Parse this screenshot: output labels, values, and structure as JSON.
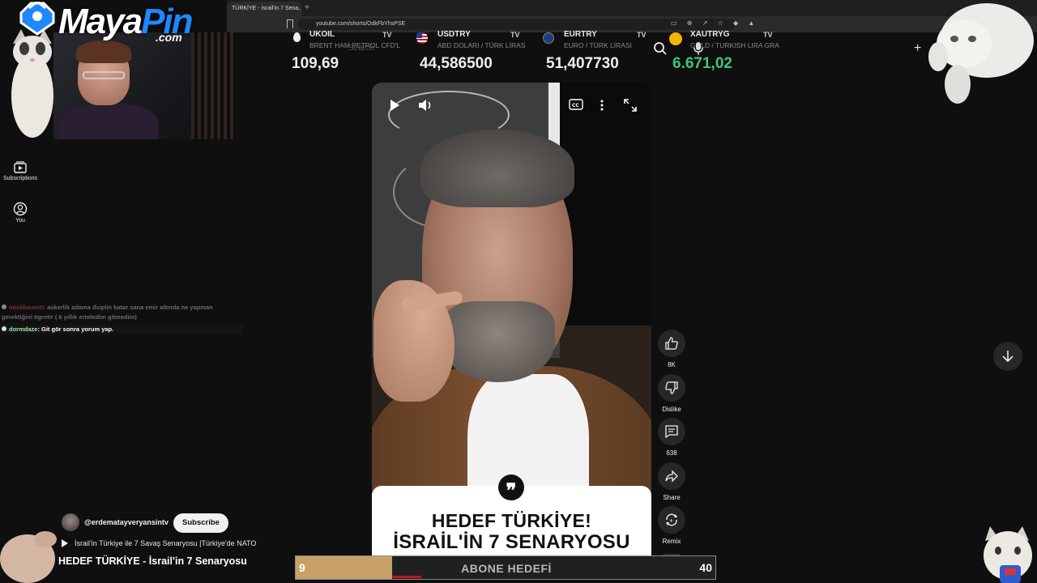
{
  "browser": {
    "tab_title": "TÜRKİYE - İsrail'in 7 Sena...",
    "url": "youtube.com/shorts/OdkFbYhsPSE"
  },
  "brand": {
    "logo_main": "Maya",
    "logo_accent": "Pin",
    "logo_suffix": ".com",
    "accent_color": "#1e88ff"
  },
  "ticker": [
    {
      "symbol": "UKOIL",
      "desc": "BRENT HAM PETROL CFD'L",
      "value": "109,69",
      "value_color": "#eeeeee",
      "icon": "oil-drop-icon"
    },
    {
      "symbol": "USDTRY",
      "desc": "ABD DOLARI / TÜRK LİRAS",
      "value": "44,586500",
      "value_color": "#eeeeee",
      "icon": "us-flag-icon"
    },
    {
      "symbol": "EURTRY",
      "desc": "EURO / TÜRK LİRASI",
      "value": "51,407730",
      "value_color": "#eeeeee",
      "icon": "eu-flag-icon"
    },
    {
      "symbol": "XAUTRYG",
      "desc": "GOLD / TURKISH LIRA GRA",
      "value": "6.671,02",
      "value_color": "#3fc47a",
      "icon": "gold-icon"
    }
  ],
  "ticker_badge": "TV",
  "search": {
    "placeholder": "Search"
  },
  "sidebar": {
    "items": [
      {
        "label": "Subscriptions",
        "icon": "subscriptions-icon"
      },
      {
        "label": "You",
        "icon": "you-icon"
      }
    ]
  },
  "chat": {
    "messages": [
      {
        "user": "noctilucentt",
        "text": ": askerlik adama dsiplin katar sana emir altında ne yapman gerektiğini ögretir ( 6 yıllık erteledim gitmedim)"
      },
      {
        "user": "dormdaze",
        "text": ": Git gör sonra yorum yap."
      }
    ]
  },
  "video": {
    "caption_line1": "HEDEF TÜRKİYE!",
    "caption_line2": "İSRAİL'İN 7 SENARYOSU",
    "quote_glyph": "❞"
  },
  "actions": {
    "like_count": "8K",
    "dislike_label": "Dislike",
    "comment_count": "638",
    "share_label": "Share",
    "remix_label": "Remix"
  },
  "channel": {
    "handle": "@erdematayveryansintv",
    "subscribe_label": "Subscribe",
    "playlist_text": "İsrail'in Türkiye ile 7 Savaş Senaryosu |Türkiye'de NATO",
    "title": "HEDEF TÜRKİYE - İsrail'in 7 Senaryosu"
  },
  "sub_goal": {
    "label": "ABONE HEDEFİ",
    "start": "9",
    "end": "40",
    "progress": 0.23,
    "fill_color": "#c7a166"
  }
}
